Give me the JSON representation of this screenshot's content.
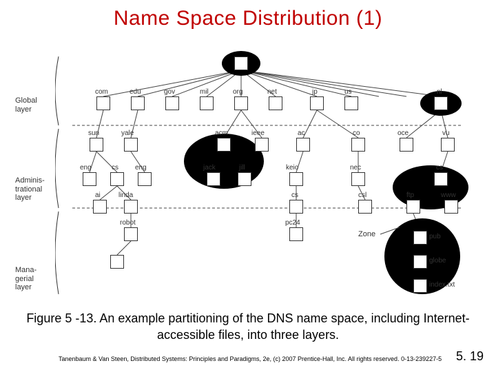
{
  "title": "Name Space Distribution (1)",
  "layers": {
    "global": "Global\nlayer",
    "admin": "Adminis-\ntrational\nlayer",
    "manag": "Mana-\ngerial\nlayer"
  },
  "nodes": {
    "tlds": [
      "com",
      "edu",
      "gov",
      "mil",
      "org",
      "net",
      "jp",
      "us",
      ".",
      ".",
      "nl"
    ],
    "row2": [
      "sun",
      "yale",
      "",
      "",
      "acm",
      "ieee",
      "ac",
      "",
      "co",
      "oce",
      "vu"
    ],
    "row3": [
      "eng",
      "cs",
      "eng",
      "",
      "jack",
      "jill",
      "keio",
      "",
      "nec",
      "",
      "cs"
    ],
    "row4": [
      "ai",
      "linda",
      "",
      "",
      "",
      "",
      "cs",
      "",
      "csl",
      "ftp",
      "www"
    ],
    "row5": [
      "",
      "robot",
      "",
      "",
      "",
      "",
      "pc24",
      "",
      "",
      "pub",
      ""
    ],
    "row6": [
      "",
      "",
      "",
      "",
      "",
      "",
      "",
      "",
      "",
      "globe",
      ""
    ],
    "row7": [
      "",
      "",
      "",
      "",
      "",
      "",
      "",
      "",
      "",
      "index.txt",
      ""
    ]
  },
  "zone_label": "Zone",
  "caption": "Figure 5 -13. An example partitioning of the DNS name space, including Internet-accessible files, into three layers.",
  "footer": "Tanenbaum & Van Steen, Distributed Systems: Principles and Paradigms, 2e, (c) 2007 Prentice-Hall, Inc. All rights reserved. 0-13-239227-5",
  "page_number": "5. 19"
}
